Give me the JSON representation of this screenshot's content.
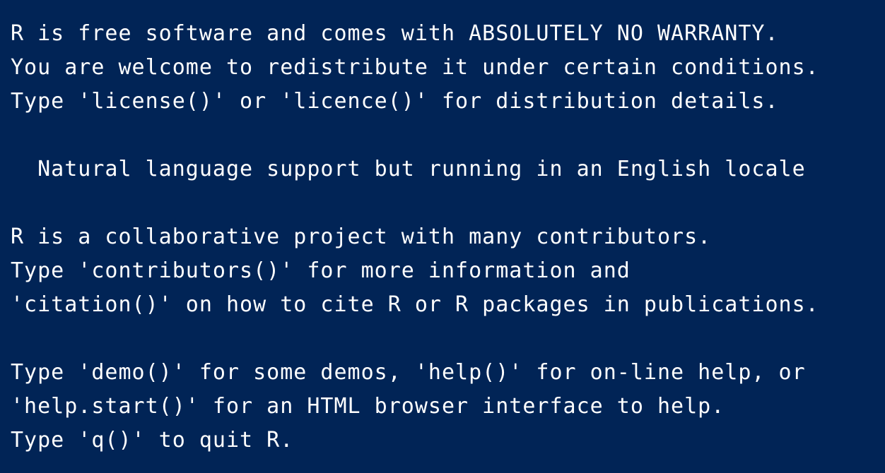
{
  "terminal": {
    "theme": {
      "background": "#012456",
      "foreground": "#ffffff"
    },
    "lines": [
      "R is free software and comes with ABSOLUTELY NO WARRANTY.",
      "You are welcome to redistribute it under certain conditions.",
      "Type 'license()' or 'licence()' for distribution details.",
      "",
      "  Natural language support but running in an English locale",
      "",
      "R is a collaborative project with many contributors.",
      "Type 'contributors()' for more information and",
      "'citation()' on how to cite R or R packages in publications.",
      "",
      "Type 'demo()' for some demos, 'help()' for on-line help, or",
      "'help.start()' for an HTML browser interface to help.",
      "Type 'q()' to quit R."
    ]
  }
}
